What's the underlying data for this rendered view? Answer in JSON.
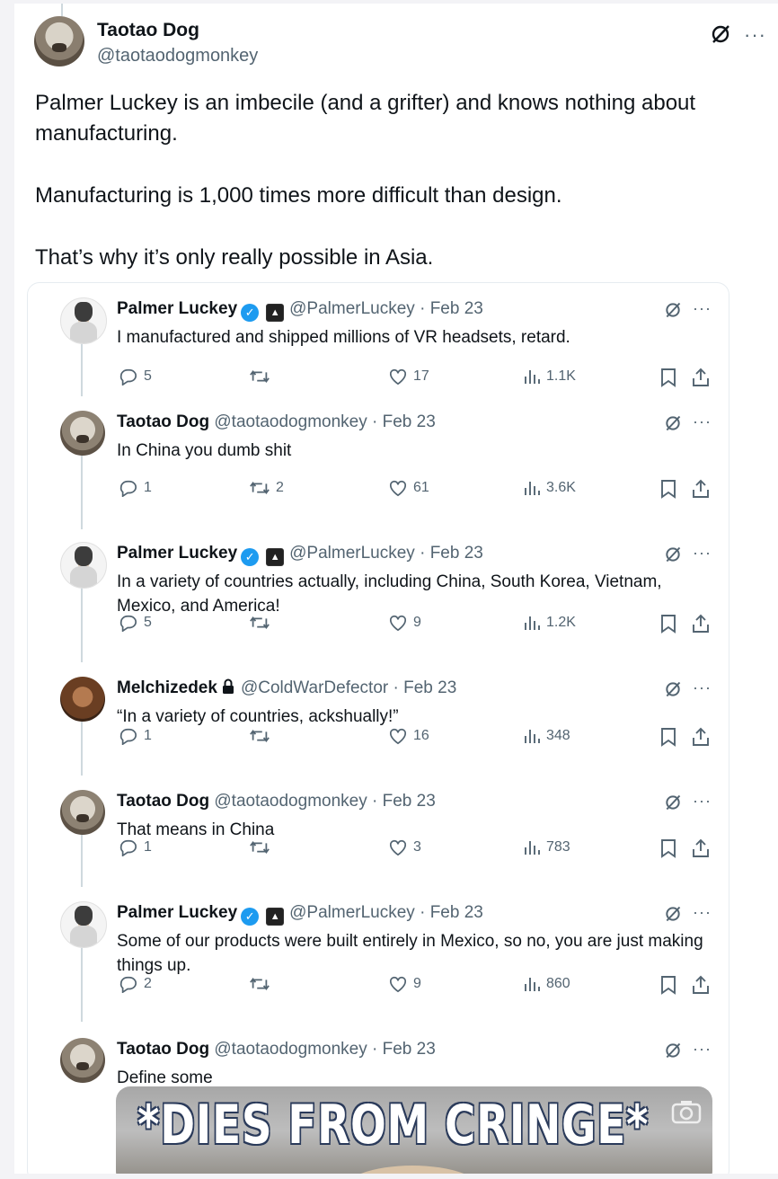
{
  "main_post": {
    "author_name": "Taotao Dog",
    "author_handle": "@taotaodogmonkey",
    "paragraphs": [
      "Palmer Luckey is an imbecile (and a grifter) and knows nothing about manufacturing.",
      "Manufacturing is 1,000 times more difficult than design.",
      "That’s why it’s only really possible in Asia."
    ],
    "more_label": "···"
  },
  "replies": [
    {
      "name": "Palmer Luckey",
      "handle": "@PalmerLuckey",
      "date": "· Feb 23",
      "text": "I manufactured and shipped millions of VR headsets, retard.",
      "replies": "5",
      "retweets": "",
      "likes": "17",
      "views": "1.1K",
      "verified": true,
      "affiliate": true,
      "avatar": "palmer"
    },
    {
      "name": "Taotao Dog",
      "handle": "@taotaodogmonkey",
      "date": "· Feb 23",
      "text": "In China you dumb shit",
      "replies": "1",
      "retweets": "2",
      "likes": "61",
      "views": "3.6K",
      "verified": false,
      "affiliate": false,
      "avatar": "taotao"
    },
    {
      "name": "Palmer Luckey",
      "handle": "@PalmerLuckey",
      "date": "· Feb 23",
      "text": "In a variety of countries actually, including China, South Korea, Vietnam, Mexico, and America!",
      "replies": "5",
      "retweets": "",
      "likes": "9",
      "views": "1.2K",
      "verified": true,
      "affiliate": true,
      "avatar": "palmer"
    },
    {
      "name": "Melchizedek",
      "handle": "@ColdWarDefector",
      "date": "· Feb 23",
      "text": "“In a variety of countries, ackshually!”",
      "replies": "1",
      "retweets": "",
      "likes": "16",
      "views": "348",
      "verified": false,
      "affiliate": false,
      "locked": true,
      "avatar": "melch"
    },
    {
      "name": "Taotao Dog",
      "handle": "@taotaodogmonkey",
      "date": "· Feb 23",
      "text": "That means in China",
      "replies": "1",
      "retweets": "",
      "likes": "3",
      "views": "783",
      "verified": false,
      "affiliate": false,
      "avatar": "taotao"
    },
    {
      "name": "Palmer Luckey",
      "handle": "@PalmerLuckey",
      "date": "· Feb 23",
      "text": "Some of our products were built entirely in Mexico, so no, you are just making things up.",
      "replies": "2",
      "retweets": "",
      "likes": "9",
      "views": "860",
      "verified": true,
      "affiliate": true,
      "avatar": "palmer"
    },
    {
      "name": "Taotao Dog",
      "handle": "@taotaodogmonkey",
      "date": "· Feb 23",
      "text": "Define some",
      "verified": false,
      "affiliate": false,
      "avatar": "taotao"
    }
  ],
  "media": {
    "caption": "*DIES FROM CRINGE*"
  },
  "colors": {
    "text": "#0f1419",
    "muted": "#536471",
    "verified": "#1d9bf0",
    "line": "#cfd9de"
  }
}
